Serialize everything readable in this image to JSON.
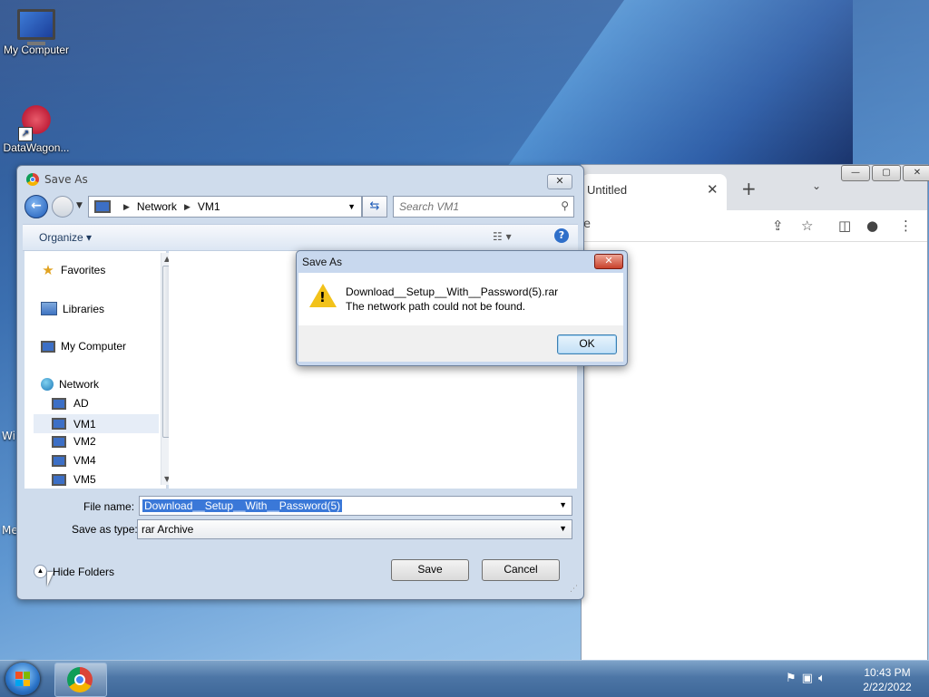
{
  "desktop": {
    "icons": [
      {
        "label": "My Computer"
      },
      {
        "label": "DataWagon..."
      }
    ],
    "side_fragments": [
      "Wi",
      "Me"
    ]
  },
  "chrome_window": {
    "tab_title": "Untitled",
    "tab_close": "✕",
    "new_tab": "+",
    "tab_menu": "⌄",
    "url_fragment": "e",
    "toolbar_icons": [
      "share-icon",
      "star-icon",
      "sidebar-icon",
      "profile-icon",
      "menu-icon"
    ]
  },
  "save_dialog": {
    "title": "Save As",
    "address": {
      "root": "Network",
      "leaf": "VM1"
    },
    "search_placeholder": "Search VM1",
    "organize_label": "Organize ▾",
    "nav": {
      "favorites": "Favorites",
      "libraries": "Libraries",
      "my_computer": "My Computer",
      "network": "Network",
      "network_items": [
        "AD",
        "VM1",
        "VM2",
        "VM4",
        "VM5"
      ],
      "selected": "VM1"
    },
    "file_name_label": "File name:",
    "file_name_value": "Download__Setup__With__Password(5)",
    "save_as_type_label": "Save as type:",
    "save_as_type_value": "rar Archive",
    "hide_folders_label": "Hide Folders",
    "save_button": "Save",
    "cancel_button": "Cancel"
  },
  "error_dialog": {
    "title": "Save As",
    "close": "✕",
    "line1": "Download__Setup__With__Password(5).rar",
    "line2": "The network path could not be found.",
    "ok_button": "OK"
  },
  "taskbar": {
    "time": "10:43 PM",
    "date": "2/22/2022"
  }
}
